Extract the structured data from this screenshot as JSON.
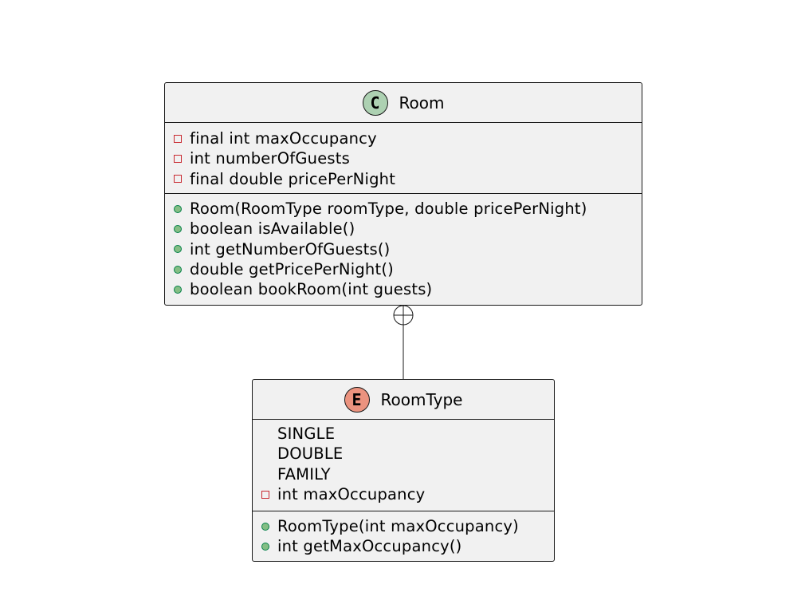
{
  "classes": {
    "room": {
      "stereotype_letter": "C",
      "name": "Room",
      "attributes": [
        {
          "visibility": "private",
          "text": "final int maxOccupancy"
        },
        {
          "visibility": "private",
          "text": "int numberOfGuests"
        },
        {
          "visibility": "private",
          "text": "final double pricePerNight"
        }
      ],
      "methods": [
        {
          "visibility": "public",
          "text": "Room(RoomType roomType, double pricePerNight)"
        },
        {
          "visibility": "public",
          "text": "boolean isAvailable()"
        },
        {
          "visibility": "public",
          "text": "int getNumberOfGuests()"
        },
        {
          "visibility": "public",
          "text": "double getPricePerNight()"
        },
        {
          "visibility": "public",
          "text": "boolean bookRoom(int guests)"
        }
      ]
    },
    "roomtype": {
      "stereotype_letter": "E",
      "name": "RoomType",
      "attributes": [
        {
          "visibility": "none",
          "text": "SINGLE"
        },
        {
          "visibility": "none",
          "text": "DOUBLE"
        },
        {
          "visibility": "none",
          "text": "FAMILY"
        },
        {
          "visibility": "private",
          "text": "int maxOccupancy"
        }
      ],
      "methods": [
        {
          "visibility": "public",
          "text": "RoomType(int maxOccupancy)"
        },
        {
          "visibility": "public",
          "text": "int getMaxOccupancy()"
        }
      ]
    }
  },
  "colors": {
    "class_fill": "#f1f1f1",
    "border": "#181818",
    "class_circle": "#add1b2",
    "enum_circle": "#eb937f",
    "private_marker": "#c82930",
    "public_marker_fill": "#84be84",
    "public_marker_border": "#038048"
  },
  "relations": [
    {
      "from": "RoomType",
      "to": "Room",
      "type": "nested"
    }
  ]
}
